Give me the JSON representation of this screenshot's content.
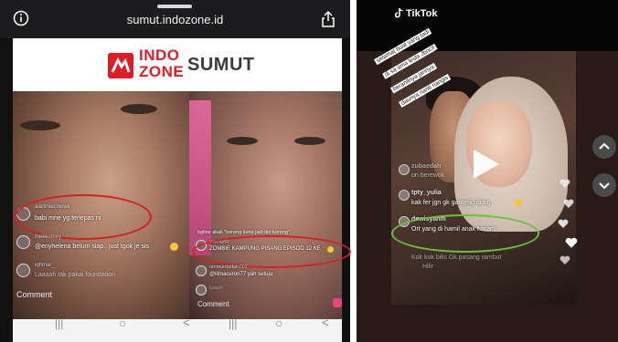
{
  "left_phone": {
    "url": "sumut.indozone.id",
    "banner": {
      "brand_top": "INDO",
      "brand_bottom": "ZONE",
      "region": "SUMUT"
    },
    "left_video": {
      "comments": [
        {
          "user": "aliefmiecowwil",
          "text": "babi mne yg terlepas ni"
        },
        {
          "user": "mekkomey",
          "text": "@enyhelena belum siap.. just tgok je sis"
        },
        {
          "user": "iqhmar_",
          "text": "Laaaah tak pakai foundation"
        }
      ],
      "comment_placeholder": "Comment"
    },
    "right_video": {
      "comments": [
        {
          "user": "",
          "text": "bgline akak \"koreng kena jadi diri koreng\""
        },
        {
          "user": "acungloy",
          "text": "ZOMBIE KAMPUNG PISANG EPISOD 12 KE"
        },
        {
          "user": "ummurdalfah710",
          "text": "@lilmaceron77 yah setuju"
        },
        {
          "user": "kaseh",
          "text": ""
        }
      ],
      "comment_placeholder": "Comment"
    },
    "nav": {
      "recent": "|||",
      "home": "○",
      "back": "<"
    }
  },
  "right_phone": {
    "app_name": "TikTok",
    "sticker_lines": [
      "selamat buat yang tadi",
      "di sa ama lesbi Jbocil",
      "beranilnya jarinya",
      "daunya nanti nangis"
    ],
    "comments": [
      {
        "user": "zubaedah",
        "text": "on berewok"
      },
      {
        "user": "",
        "text": "kak fer jgn gk ganteng dong"
      },
      {
        "user": "tpty_yulia",
        "text": ""
      },
      {
        "user": "dewisyahm",
        "text": "Ort yang di hamil anak haram"
      },
      {
        "user": "",
        "text": "Kok kok bilis Gk pasang rambut"
      },
      {
        "user": "",
        "text": "Hilir"
      }
    ]
  },
  "colors": {
    "brand_red": "#e11d23",
    "highlight_red": "#d62020",
    "highlight_green": "#6ac23a"
  }
}
